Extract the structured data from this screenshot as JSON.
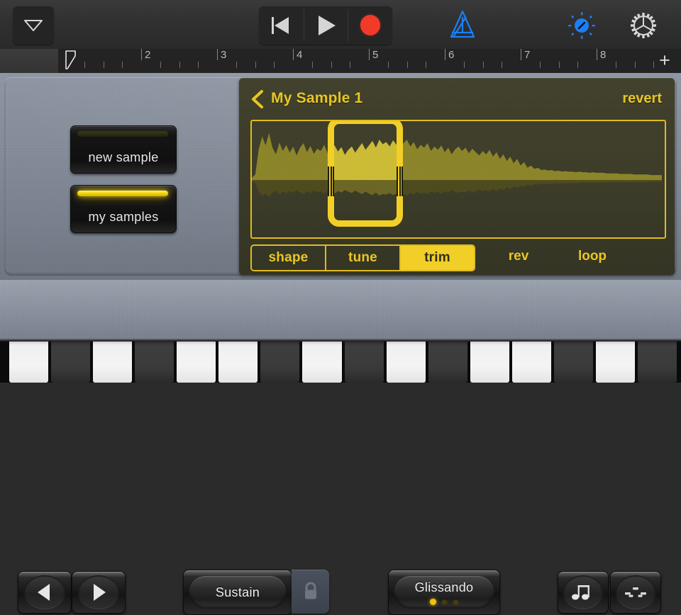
{
  "toolbar": {
    "nav_button": "navigation-triangle",
    "transport": [
      {
        "name": "rewind",
        "label": "Rewind"
      },
      {
        "name": "play",
        "label": "Play"
      },
      {
        "name": "record",
        "label": "Record"
      }
    ],
    "metronome": "metronome",
    "fx": "fx-knob",
    "settings": "settings-gear",
    "record_color": "#f23a29",
    "metronome_color": "#1b7ff5",
    "fx_color": "#1b7ff5"
  },
  "ruler": {
    "measures": [
      "2",
      "3",
      "4",
      "5",
      "6",
      "7",
      "8"
    ],
    "playhead_position": "1",
    "add_section_label": "+"
  },
  "sampler": {
    "new_sample_label": "new sample",
    "my_samples_label": "my samples",
    "new_sample_led_on": false,
    "my_samples_led_on": true,
    "accent_color": "#f2cf27",
    "screen_bg": "#3b3b28",
    "title": "My Sample 1",
    "revert_label": "revert",
    "back_label": "Back",
    "tabs": [
      {
        "label": "shape",
        "active": false,
        "grouped": true
      },
      {
        "label": "tune",
        "active": false,
        "grouped": true
      },
      {
        "label": "trim",
        "active": true,
        "grouped": true
      },
      {
        "label": "rev",
        "active": false,
        "grouped": false
      },
      {
        "label": "loop",
        "active": false,
        "grouped": false
      }
    ],
    "trim": {
      "start_percent": 18.5,
      "end_percent": 36.8
    },
    "waveform": {
      "top": [
        0.04,
        0.1,
        0.55,
        0.78,
        0.62,
        0.84,
        0.58,
        0.46,
        0.67,
        0.52,
        0.63,
        0.49,
        0.6,
        0.44,
        0.58,
        0.66,
        0.5,
        0.61,
        0.47,
        0.56,
        0.52,
        0.63,
        0.48,
        0.57,
        0.62,
        0.51,
        0.59,
        0.45,
        0.54,
        0.6,
        0.49,
        0.58,
        0.66,
        0.54,
        0.62,
        0.7,
        0.58,
        0.72,
        0.64,
        0.68,
        0.6,
        0.71,
        0.63,
        0.57,
        0.66,
        0.72,
        0.6,
        0.68,
        0.55,
        0.63,
        0.58,
        0.66,
        0.52,
        0.6,
        0.54,
        0.62,
        0.5,
        0.58,
        0.46,
        0.55,
        0.6,
        0.52,
        0.58,
        0.48,
        0.56,
        0.5,
        0.44,
        0.52,
        0.46,
        0.54,
        0.42,
        0.5,
        0.38,
        0.46,
        0.34,
        0.42,
        0.3,
        0.38,
        0.26,
        0.32,
        0.22,
        0.26,
        0.2,
        0.22,
        0.18,
        0.19,
        0.17,
        0.18,
        0.16,
        0.17,
        0.15,
        0.16,
        0.15,
        0.15,
        0.14,
        0.15,
        0.14,
        0.14,
        0.13,
        0.14,
        0.13,
        0.13,
        0.13,
        0.12,
        0.12,
        0.12,
        0.12,
        0.11,
        0.11,
        0.11,
        0.11,
        0.1,
        0.1,
        0.1,
        0.1,
        0.1,
        0.09,
        0.09,
        0.09,
        0.09
      ],
      "bottom": [
        0.03,
        0.06,
        0.22,
        0.3,
        0.26,
        0.32,
        0.24,
        0.2,
        0.28,
        0.22,
        0.26,
        0.21,
        0.25,
        0.19,
        0.24,
        0.27,
        0.21,
        0.25,
        0.2,
        0.23,
        0.22,
        0.26,
        0.2,
        0.24,
        0.26,
        0.21,
        0.24,
        0.19,
        0.22,
        0.25,
        0.2,
        0.24,
        0.27,
        0.22,
        0.26,
        0.29,
        0.24,
        0.3,
        0.27,
        0.28,
        0.25,
        0.29,
        0.26,
        0.24,
        0.27,
        0.3,
        0.25,
        0.28,
        0.23,
        0.26,
        0.24,
        0.27,
        0.22,
        0.25,
        0.22,
        0.26,
        0.21,
        0.24,
        0.19,
        0.23,
        0.25,
        0.22,
        0.24,
        0.2,
        0.23,
        0.21,
        0.18,
        0.22,
        0.19,
        0.22,
        0.17,
        0.21,
        0.16,
        0.19,
        0.14,
        0.17,
        0.12,
        0.15,
        0.11,
        0.13,
        0.09,
        0.11,
        0.08,
        0.09,
        0.07,
        0.08,
        0.07,
        0.07,
        0.06,
        0.07,
        0.06,
        0.06,
        0.06,
        0.06,
        0.06,
        0.06,
        0.05,
        0.05,
        0.05,
        0.05,
        0.05,
        0.05,
        0.05,
        0.05,
        0.04,
        0.04,
        0.04,
        0.04,
        0.04,
        0.04,
        0.04,
        0.04,
        0.04,
        0.04,
        0.04,
        0.04,
        0.03,
        0.03,
        0.03,
        0.03
      ]
    }
  },
  "controls": {
    "octave_down": "octave-down",
    "octave_up": "octave-up",
    "sustain_label": "Sustain",
    "lock_label": "lock",
    "glissando_label": "Glissando",
    "glissando_leds": [
      true,
      false,
      false
    ],
    "notes_button": "note-values",
    "arp_button": "arpeggiator"
  },
  "keyboard": {
    "keys": [
      {
        "type": "white"
      },
      {
        "type": "black"
      },
      {
        "type": "white"
      },
      {
        "type": "black"
      },
      {
        "type": "white"
      },
      {
        "type": "white"
      },
      {
        "type": "black"
      },
      {
        "type": "white"
      },
      {
        "type": "black"
      },
      {
        "type": "white"
      },
      {
        "type": "black"
      },
      {
        "type": "white"
      },
      {
        "type": "white"
      },
      {
        "type": "black"
      },
      {
        "type": "white"
      },
      {
        "type": "black"
      }
    ]
  }
}
